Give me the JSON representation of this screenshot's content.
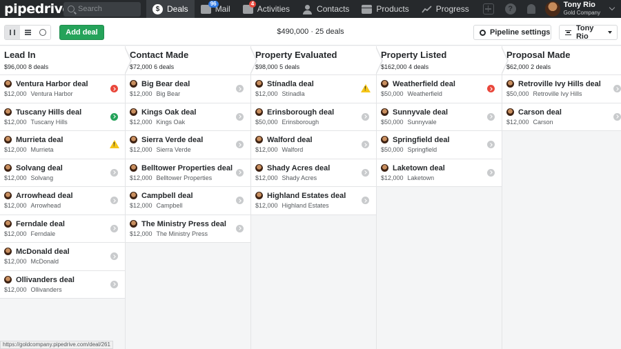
{
  "nav": {
    "logo": "pipedrive",
    "search_placeholder": "Search",
    "items": [
      {
        "label": "Deals",
        "icon": "dollar-icon",
        "active": true
      },
      {
        "label": "Mail",
        "icon": "mail-icon",
        "badge": "96"
      },
      {
        "label": "Activities",
        "icon": "calendar-icon",
        "badge": "4"
      },
      {
        "label": "Contacts",
        "icon": "person-icon"
      },
      {
        "label": "Products",
        "icon": "box-icon"
      },
      {
        "label": "Progress",
        "icon": "trend-icon"
      }
    ],
    "user": {
      "name": "Tony Rio",
      "company": "Gold Company"
    }
  },
  "toolbar": {
    "add_deal_label": "Add deal",
    "total_value": "$490,000",
    "separator": "·",
    "deal_count": "25 deals",
    "pipeline_settings_label": "Pipeline settings",
    "owner_filter_label": "Tony Rio"
  },
  "stages": [
    {
      "name": "Lead In",
      "amount": "$96,000",
      "count": "8 deals",
      "deals": [
        {
          "title": "Ventura Harbor deal",
          "value": "$12,000",
          "org": "Ventura Harbor",
          "status": "red"
        },
        {
          "title": "Tuscany Hills deal",
          "value": "$12,000",
          "org": "Tuscany Hills",
          "status": "green"
        },
        {
          "title": "Murrieta deal",
          "value": "$12,000",
          "org": "Murrieta",
          "status": "warn"
        },
        {
          "title": "Solvang deal",
          "value": "$12,000",
          "org": "Solvang",
          "status": "grey"
        },
        {
          "title": "Arrowhead deal",
          "value": "$12,000",
          "org": "Arrowhead",
          "status": "grey"
        },
        {
          "title": "Ferndale deal",
          "value": "$12,000",
          "org": "Ferndale",
          "status": "grey"
        },
        {
          "title": "McDonald deal",
          "value": "$12,000",
          "org": "McDonald",
          "status": "grey"
        },
        {
          "title": "Ollivanders deal",
          "value": "$12,000",
          "org": "Ollivanders",
          "status": "grey"
        }
      ]
    },
    {
      "name": "Contact Made",
      "amount": "$72,000",
      "count": "6 deals",
      "deals": [
        {
          "title": "Big Bear deal",
          "value": "$12,000",
          "org": "Big Bear",
          "status": "grey"
        },
        {
          "title": "Kings Oak deal",
          "value": "$12,000",
          "org": "Kings Oak",
          "status": "grey"
        },
        {
          "title": "Sierra Verde deal",
          "value": "$12,000",
          "org": "Sierra Verde",
          "status": "grey"
        },
        {
          "title": "Belltower Properties deal",
          "value": "$12,000",
          "org": "Belltower Properties",
          "status": "grey"
        },
        {
          "title": "Campbell deal",
          "value": "$12,000",
          "org": "Campbell",
          "status": "grey"
        },
        {
          "title": "The Ministry Press deal",
          "value": "$12,000",
          "org": "The Ministry Press",
          "status": "grey"
        }
      ]
    },
    {
      "name": "Property Evaluated",
      "amount": "$98,000",
      "count": "5 deals",
      "deals": [
        {
          "title": "Stínadla deal",
          "value": "$12,000",
          "org": "Stínadla",
          "status": "warn"
        },
        {
          "title": "Erinsborough deal",
          "value": "$50,000",
          "org": "Erinsborough",
          "status": "grey"
        },
        {
          "title": "Walford deal",
          "value": "$12,000",
          "org": "Walford",
          "status": "grey"
        },
        {
          "title": "Shady Acres deal",
          "value": "$12,000",
          "org": "Shady Acres",
          "status": "grey"
        },
        {
          "title": "Highland Estates deal",
          "value": "$12,000",
          "org": "Highland Estates",
          "status": "grey"
        }
      ]
    },
    {
      "name": "Property Listed",
      "amount": "$162,000",
      "count": "4 deals",
      "deals": [
        {
          "title": "Weatherfield deal",
          "value": "$50,000",
          "org": "Weatherfield",
          "status": "red"
        },
        {
          "title": "Sunnyvale deal",
          "value": "$50,000",
          "org": "Sunnyvale",
          "status": "grey"
        },
        {
          "title": "Springfield deal",
          "value": "$50,000",
          "org": "Springfield",
          "status": "grey"
        },
        {
          "title": "Laketown deal",
          "value": "$12,000",
          "org": "Laketown",
          "status": "grey"
        }
      ]
    },
    {
      "name": "Proposal Made",
      "amount": "$62,000",
      "count": "2 deals",
      "deals": [
        {
          "title": "Retroville Ivy Hills deal",
          "value": "$50,000",
          "org": "Retroville Ivy Hills",
          "status": "grey"
        },
        {
          "title": "Carson deal",
          "value": "$12,000",
          "org": "Carson",
          "status": "grey"
        }
      ]
    }
  ],
  "status_bar_url": "https://goldcompany.pipedrive.com/deal/261",
  "colors": {
    "accent_green": "#25a35a",
    "nav_bg": "#26292c",
    "overdue_red": "#e9473b",
    "warning_yellow": "#f5c518"
  }
}
